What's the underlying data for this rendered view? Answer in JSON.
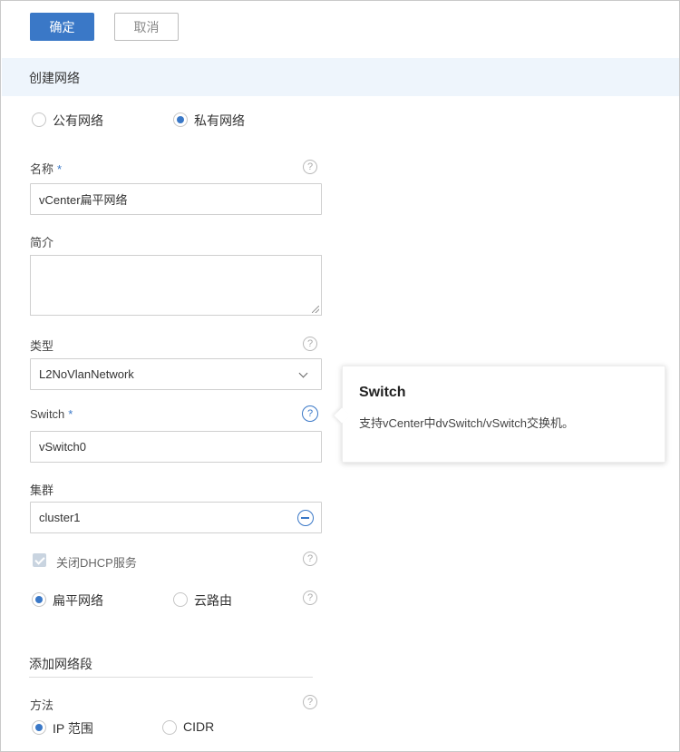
{
  "toolbar": {
    "confirm_label": "确定",
    "cancel_label": "取消"
  },
  "section": {
    "title": "创建网络"
  },
  "network_scope": {
    "options": [
      {
        "label": "公有网络",
        "selected": false
      },
      {
        "label": "私有网络",
        "selected": true
      }
    ]
  },
  "form": {
    "name": {
      "label": "名称",
      "required": "*",
      "value": "vCenter扁平网络"
    },
    "description": {
      "label": "简介",
      "value": ""
    },
    "type": {
      "label": "类型",
      "value": "L2NoVlanNetwork"
    },
    "switch": {
      "label": "Switch",
      "required": "*",
      "value": "vSwitch0"
    },
    "cluster": {
      "label": "集群",
      "value": "cluster1"
    },
    "dhcp": {
      "label": "关闭DHCP服务",
      "checked": true
    },
    "network_mode": {
      "options": [
        {
          "label": "扁平网络",
          "selected": true
        },
        {
          "label": "云路由",
          "selected": false
        }
      ]
    }
  },
  "segment": {
    "title": "添加网络段",
    "method_label": "方法",
    "options": [
      {
        "label": "IP 范围",
        "selected": true
      },
      {
        "label": "CIDR",
        "selected": false
      }
    ]
  },
  "tooltip": {
    "title": "Switch",
    "body": "支持vCenter中dvSwitch/vSwitch交换机。"
  },
  "icons": {
    "help": "?",
    "accent": "#3a78c7"
  }
}
